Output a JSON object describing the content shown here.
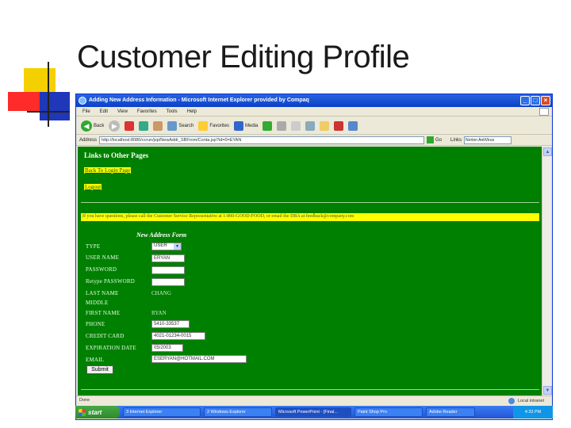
{
  "slide": {
    "title": "Customer Editing Profile"
  },
  "browser": {
    "title": "Adding New Address Information - Microsoft Internet Explorer provided by Compaq",
    "menu": [
      "File",
      "Edit",
      "View",
      "Favorites",
      "Tools",
      "Help"
    ],
    "toolbar": {
      "back": "Back",
      "search": "Search",
      "favorites": "Favorites",
      "media": "Media"
    },
    "address": {
      "label": "Address",
      "url": "http://localhost:8080/ccrun/jsp/NewAddr_SBFrom/Conta.jsp?id=0=EYAN",
      "go": "Go",
      "links": "Links",
      "search_placeholder": "Norton AntiVirus"
    },
    "status": {
      "text": "Done",
      "zone": "Local intranet"
    }
  },
  "page": {
    "links_heading": "Links to Other Pages",
    "back_link": "Back To Login Page",
    "logout_link": "Logout",
    "notice": "If you have questions, please call the Customer Service Representative at 1-800-GOOD-FOOD, or email the DBA at feedback@company.com",
    "form_heading": "New Address Form",
    "fields": {
      "type_label": "TYPE",
      "type_value": "USER",
      "username_label": "USER NAME",
      "username_value": "ERYAN",
      "password_label": "PASSWORD",
      "retype_label": "Retype PASSWORD",
      "lastname_label": "LAST NAME",
      "lastname_value": "CHANG",
      "mi_label": "MIDDLE",
      "firstname_label": "FIRST NAME",
      "firstname_value": "RYAN",
      "phone_label": "PHONE",
      "phone_value": "5410-33537",
      "credit_label": "CREDIT CARD",
      "credit_value": "4021-01234-0015",
      "expiration_label": "EXPIRATION DATE",
      "expiration_value": "05/2003",
      "email_label": "EMAIL",
      "email_value": "ESERYAN@HOTMAIL.COM"
    },
    "submit": "Submit"
  },
  "taskbar": {
    "start": "start",
    "tasks": [
      "3 Internet Explorer",
      "2 Windows Explorer",
      "Microsoft PowerPoint - [Final...",
      "Paint Shop Pro",
      "Adobe Reader"
    ],
    "clock": "4:33 PM"
  }
}
